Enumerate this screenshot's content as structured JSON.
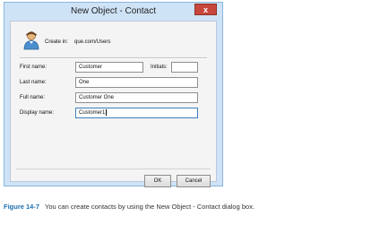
{
  "dialog": {
    "title": "New Object - Contact",
    "close_label": "x",
    "create_in_label": "Create in:",
    "create_in_path": "que.com/Users",
    "fields": {
      "first_name_label": "First name:",
      "first_name_value": "Customer",
      "initials_label": "Initials:",
      "initials_value": "",
      "last_name_label": "Last name:",
      "last_name_value": "One",
      "full_name_label": "Full name:",
      "full_name_value": "Customer One",
      "display_name_label": "Display name:",
      "display_name_value": "Customer1"
    },
    "ok_label": "OK",
    "cancel_label": "Cancel",
    "icon": "contact-icon"
  },
  "caption": {
    "figure": "Figure 14-7",
    "text": "You can create contacts by using the New Object - Contact dialog box."
  },
  "colors": {
    "frame": "#cfe3f6",
    "close": "#c7473d",
    "caption_accent": "#1c6fb1"
  }
}
